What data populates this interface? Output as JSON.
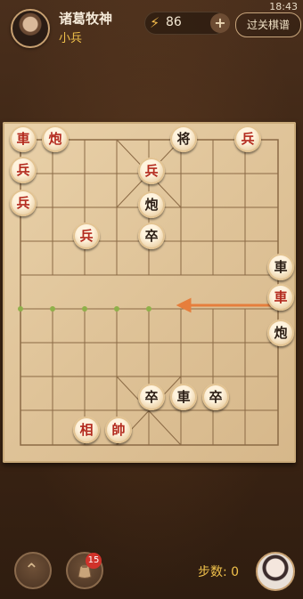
{
  "status": {
    "time": "18:43"
  },
  "player": {
    "name": "诸葛牧神",
    "rank": "小兵"
  },
  "energy": {
    "value": "86",
    "plus": "+"
  },
  "header": {
    "replay_label": "过关棋谱"
  },
  "icons": {
    "bolt": "⚡",
    "back": "⌃"
  },
  "pieces": [
    {
      "id": "r1",
      "char": "車",
      "color": "red"
    },
    {
      "id": "r2",
      "char": "炮",
      "color": "red"
    },
    {
      "id": "b1",
      "char": "将",
      "color": "black"
    },
    {
      "id": "r3",
      "char": "兵",
      "color": "red"
    },
    {
      "id": "r4",
      "char": "兵",
      "color": "red"
    },
    {
      "id": "r5",
      "char": "兵",
      "color": "red"
    },
    {
      "id": "r6",
      "char": "兵",
      "color": "red"
    },
    {
      "id": "b2",
      "char": "炮",
      "color": "black"
    },
    {
      "id": "r7",
      "char": "兵",
      "color": "red"
    },
    {
      "id": "b3",
      "char": "卒",
      "color": "black"
    },
    {
      "id": "b4",
      "char": "車",
      "color": "black"
    },
    {
      "id": "r8",
      "char": "車",
      "color": "red"
    },
    {
      "id": "b5",
      "char": "炮",
      "color": "black"
    },
    {
      "id": "b6",
      "char": "卒",
      "color": "black"
    },
    {
      "id": "b7",
      "char": "車",
      "color": "black"
    },
    {
      "id": "b8",
      "char": "卒",
      "color": "black"
    },
    {
      "id": "r9",
      "char": "相",
      "color": "red"
    },
    {
      "id": "r10",
      "char": "帥",
      "color": "red"
    }
  ],
  "bottom": {
    "badge_count": "15",
    "steps_label": "步数: 0"
  }
}
